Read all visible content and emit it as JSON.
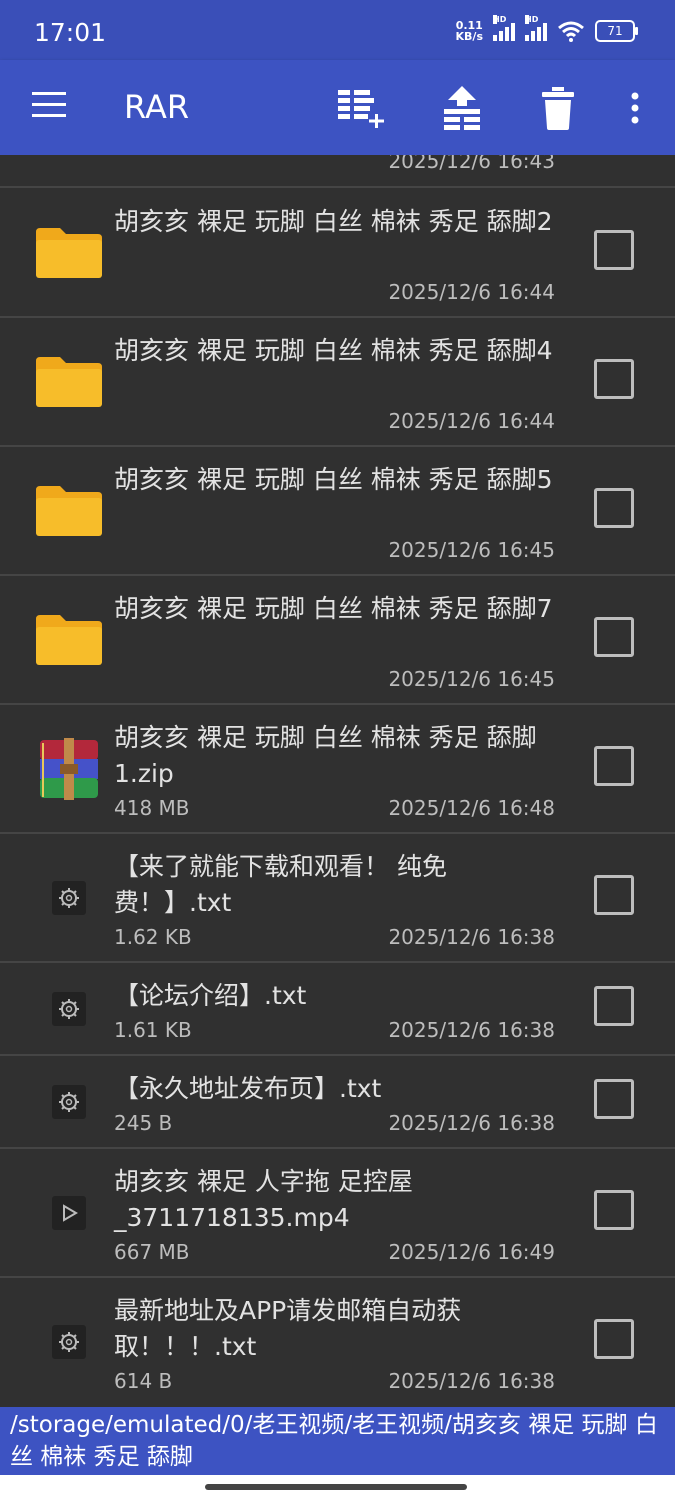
{
  "status": {
    "time": "17:01",
    "net_speed": "0.11",
    "net_unit": "KB/s",
    "hd1": "HD",
    "hd2": "HD",
    "battery": "71"
  },
  "toolbar": {
    "title": "RAR"
  },
  "list": {
    "partial_top_date": "2025/12/6 16:43",
    "items": [
      {
        "name": "胡亥亥 裸足 玩脚 白丝 棉袜 秀足 舔脚2",
        "size": "",
        "date": "2025/12/6 16:44",
        "icon": "folder-icon"
      },
      {
        "name": "胡亥亥 裸足 玩脚 白丝 棉袜 秀足 舔脚4",
        "size": "",
        "date": "2025/12/6 16:44",
        "icon": "folder-icon"
      },
      {
        "name": "胡亥亥 裸足 玩脚 白丝 棉袜 秀足 舔脚5",
        "size": "",
        "date": "2025/12/6 16:45",
        "icon": "folder-icon"
      },
      {
        "name": "胡亥亥 裸足 玩脚 白丝 棉袜 秀足 舔脚7",
        "size": "",
        "date": "2025/12/6 16:45",
        "icon": "folder-icon"
      },
      {
        "name": "胡亥亥 裸足 玩脚 白丝 棉袜 秀足 舔脚1.zip",
        "size": "418 MB",
        "date": "2025/12/6 16:48",
        "icon": "rar-archive-icon"
      },
      {
        "name": "【来了就能下载和观看！ 纯免费！】.txt",
        "size": "1.62 KB",
        "date": "2025/12/6 16:38",
        "icon": "gear-icon"
      },
      {
        "name": "【论坛介绍】.txt",
        "size": "1.61 KB",
        "date": "2025/12/6 16:38",
        "icon": "gear-icon"
      },
      {
        "name": "【永久地址发布页】.txt",
        "size": "245 B",
        "date": "2025/12/6 16:38",
        "icon": "gear-icon"
      },
      {
        "name": "胡亥亥 裸足 人字拖 足控屋_3711718135.mp4",
        "size": "667 MB",
        "date": "2025/12/6 16:49",
        "icon": "play-icon"
      },
      {
        "name": "最新地址及APP请发邮箱自动获取！！！.txt",
        "size": "614 B",
        "date": "2025/12/6 16:38",
        "icon": "gear-icon"
      }
    ]
  },
  "path": "/storage/emulated/0/老王视频/老王视频/胡亥亥 裸足 玩脚 白丝 棉袜 秀足 舔脚"
}
